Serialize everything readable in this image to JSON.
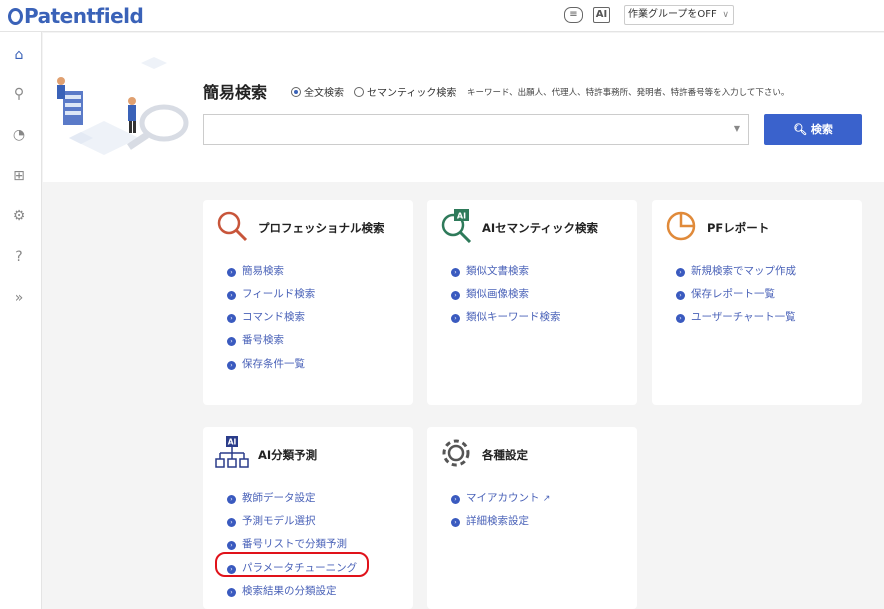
{
  "header": {
    "logo": "Patentfield",
    "workgroup_select": "作業グループをOFF",
    "icons": [
      "chat-icon",
      "ai-icon"
    ]
  },
  "nav": [
    "home-icon",
    "search-icon",
    "report-icon",
    "ai-tree-icon",
    "settings-icon",
    "help-icon",
    "expand-icon"
  ],
  "hero": {
    "title": "簡易検索",
    "radio_fulltext": "全文検索",
    "radio_semantic": "セマンティック検索",
    "hint": "キーワード、出願人、代理人、特許事務所、発明者、特許番号等を入力して下さい。",
    "search_placeholder": "",
    "search_button": "検索"
  },
  "cards": {
    "pro": {
      "title": "プロフェッショナル検索",
      "links": [
        "簡易検索",
        "フィールド検索",
        "コマンド検索",
        "番号検索",
        "保存条件一覧"
      ]
    },
    "ai_semantic": {
      "title": "AIセマンティック検索",
      "badge": "AI",
      "links": [
        "類似文書検索",
        "類似画像検索",
        "類似キーワード検索"
      ]
    },
    "pf_report": {
      "title": "PFレポート",
      "links": [
        "新規検索でマップ作成",
        "保存レポート一覧",
        "ユーザーチャート一覧"
      ]
    },
    "ai_class": {
      "title": "AI分類予測",
      "badge": "AI",
      "links": [
        "教師データ設定",
        "予測モデル選択",
        "番号リストで分類予測",
        "パラメータチューニング",
        "検索結果の分類設定"
      ]
    },
    "settings": {
      "title": "各種設定",
      "links": [
        "マイアカウント",
        "詳細検索設定"
      ]
    }
  },
  "colors": {
    "accent": "#3a62cc",
    "link": "#4a62b8",
    "highlight": "#e0121a",
    "search_icon": "#c8553a",
    "semantic_icon": "#2e7a5a",
    "report_icon": "#e08a3a"
  }
}
